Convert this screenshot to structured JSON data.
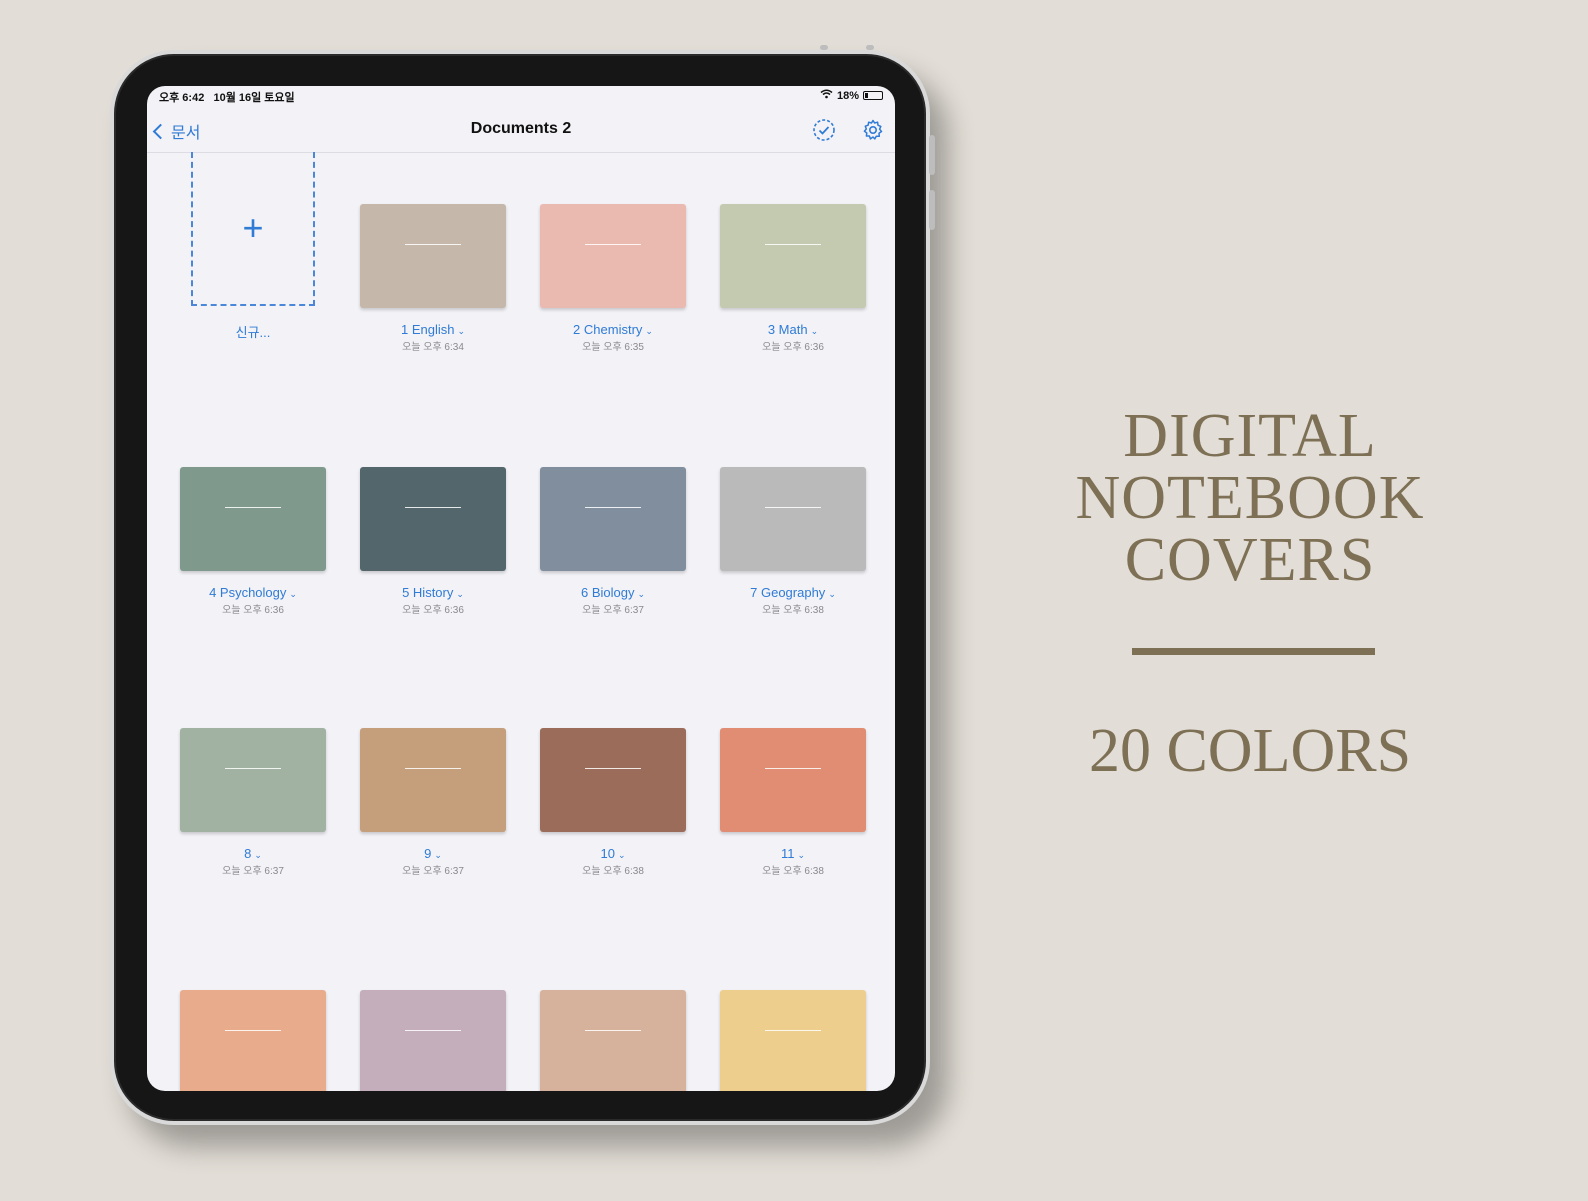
{
  "status_bar": {
    "time": "오후 6:42",
    "date": "10월 16일 토요일",
    "battery": "18%"
  },
  "nav": {
    "back_label": "문서",
    "title": "Documents 2"
  },
  "new_item": {
    "plus": "+",
    "label": "신규..."
  },
  "notebooks": [
    {
      "label": "1 English",
      "date": "오늘 오후 6:34",
      "color": "#c5b8ab"
    },
    {
      "label": "2 Chemistry",
      "date": "오늘 오후 6:35",
      "color": "#eabab1"
    },
    {
      "label": "3 Math",
      "date": "오늘 오후 6:36",
      "color": "#c4cab0"
    },
    {
      "label": "4 Psychology",
      "date": "오늘 오후 6:36",
      "color": "#7f9a8d"
    },
    {
      "label": "5 History",
      "date": "오늘 오후 6:36",
      "color": "#52666b"
    },
    {
      "label": "6 Biology",
      "date": "오늘 오후 6:37",
      "color": "#808e9e"
    },
    {
      "label": "7 Geography",
      "date": "오늘 오후 6:38",
      "color": "#bababa"
    },
    {
      "label": "8",
      "date": "오늘 오후 6:37",
      "color": "#a1b1a2"
    },
    {
      "label": "9",
      "date": "오늘 오후 6:37",
      "color": "#c59e7b"
    },
    {
      "label": "10",
      "date": "오늘 오후 6:38",
      "color": "#9b6c5a"
    },
    {
      "label": "11",
      "date": "오늘 오후 6:38",
      "color": "#e08d74"
    },
    {
      "label": "",
      "date": "",
      "color": "#e8ac8d"
    },
    {
      "label": "",
      "date": "",
      "color": "#c5aebb"
    },
    {
      "label": "",
      "date": "",
      "color": "#d6b29d"
    },
    {
      "label": "",
      "date": "",
      "color": "#eece8c"
    }
  ],
  "promo": {
    "title_line1": "DIGITAL",
    "title_line2": "NOTEBOOK",
    "title_line3": "COVERS",
    "subtitle": "20 COLORS"
  },
  "colors": {
    "accent": "#2f7bd6",
    "promo_text": "#7d7055",
    "background": "#e2ddd6",
    "screen": "#f2f2f7"
  },
  "icons": {
    "back": "chevron-left-icon",
    "select": "check-circle-icon",
    "settings": "gear-icon",
    "wifi": "wifi-icon",
    "battery": "battery-icon"
  }
}
